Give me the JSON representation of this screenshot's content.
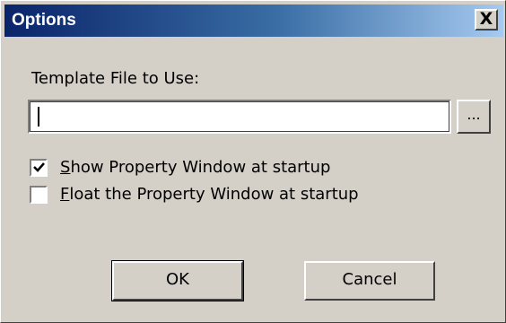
{
  "window": {
    "title": "Options",
    "close_label": "X"
  },
  "template": {
    "label": "Template File to Use:",
    "value": "",
    "browse_label": "..."
  },
  "options": [
    {
      "mnemonic": "S",
      "rest": "how Property Window at startup",
      "checked": true
    },
    {
      "mnemonic": "F",
      "rest": "loat the Property Window at startup",
      "checked": false
    }
  ],
  "buttons": {
    "ok_label": "OK",
    "cancel_label": "Cancel"
  },
  "colors": {
    "face": "#d4d0c8",
    "title_start": "#0a246a",
    "title_end": "#a6caf0",
    "title_text": "#ffffff"
  }
}
